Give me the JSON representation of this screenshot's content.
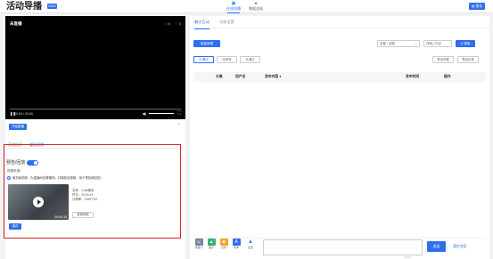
{
  "header": {
    "title": "活动导播",
    "badge": "NEW",
    "nav": [
      {
        "label": "在线导播",
        "icon": "broadcast-icon",
        "active": true
      },
      {
        "label": "数据总结",
        "icon": "data-icon",
        "active": false
      }
    ],
    "save_label": "保存"
  },
  "player": {
    "status": "未直播",
    "top_right": [
      "8",
      "0"
    ],
    "time": "00:00 / 00:00"
  },
  "pull_stream_label": "开始直播",
  "sub_tabs": [
    "直播信息",
    "暖场视频"
  ],
  "warmup": {
    "toggle_label": "预告/回放",
    "source_label": "视频来源:",
    "radio_text": "素材库视频（为直播间设置暖场，并播放该视频，用于预告和回放）",
    "duration": "00:00:15",
    "meta": [
      "名称：Cute暖场",
      "时长：00:00:15",
      "分辨率：1280*720"
    ],
    "change_label": "更换视频",
    "confirm_label": "保存"
  },
  "right": {
    "tabs": [
      "聊天互动",
      "功能设置"
    ],
    "batch_label": "批量审核",
    "select_value": "全部 / 全部",
    "search_placeholder": "请输入内容",
    "search_label": "Q 搜索",
    "filters": [
      "已通过",
      "待审核",
      "未通过"
    ],
    "export_buttons": [
      "导出列表",
      "导出记录"
    ],
    "columns": [
      "头像",
      "用户名",
      "发布内容",
      "发布时间",
      "操作"
    ],
    "tools": [
      {
        "label": "机器人",
        "icon": "robot-icon",
        "color": "#7a8699"
      },
      {
        "label": "图片",
        "icon": "image-icon",
        "color": "#3cb371"
      },
      {
        "label": "表情",
        "icon": "emoji-icon",
        "color": "#f5a623"
      },
      {
        "label": "字体",
        "icon": "font-icon",
        "color": "#2f6fed"
      },
      {
        "label": "设置",
        "icon": "user-icon",
        "color": "#2f6fed"
      }
    ],
    "counter": "0/100",
    "send_label": "发送",
    "clear_label": "清空内容"
  }
}
